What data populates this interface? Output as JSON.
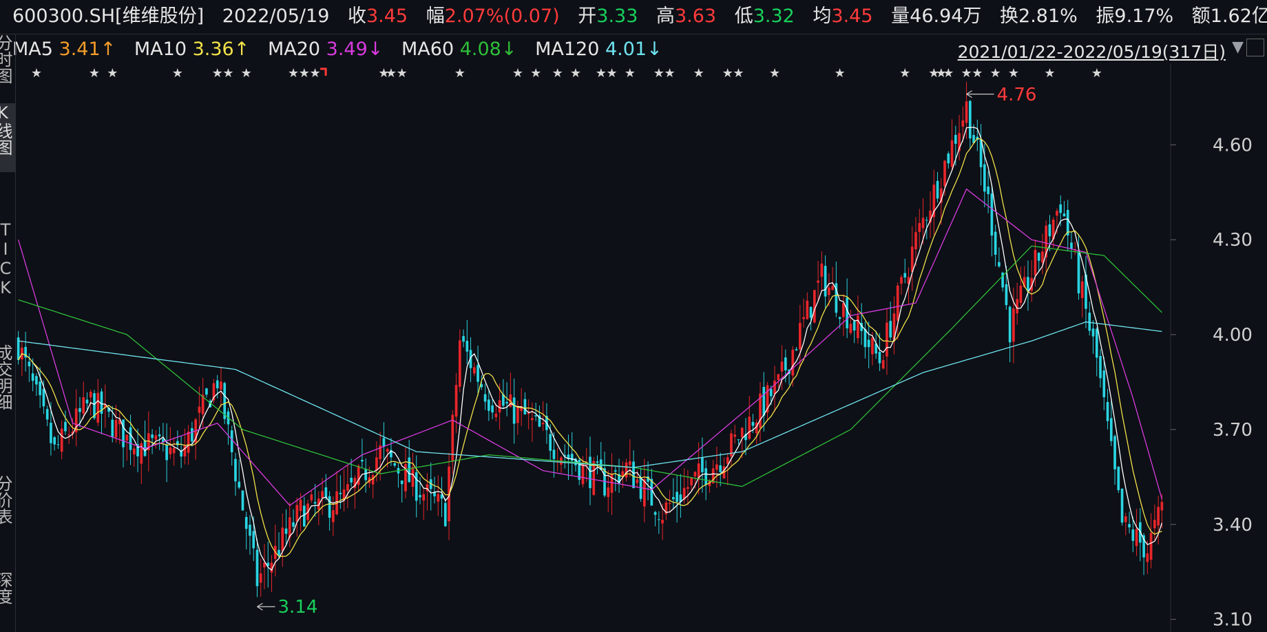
{
  "header": {
    "code": "600300.SH[维维股份]",
    "date": "2022/05/19",
    "close_label": "收",
    "close": "3.45",
    "change_label": "幅",
    "change": "2.07%(0.07)",
    "open_label": "开",
    "open": "3.33",
    "high_label": "高",
    "high": "3.63",
    "low_label": "低",
    "low": "3.32",
    "avg_label": "均",
    "avg": "3.45",
    "vol_label": "量",
    "vol": "46.94万",
    "turnover_label": "换",
    "turnover": "2.81%",
    "amp_label": "振",
    "amp": "9.17%",
    "amount_label": "额",
    "amount": "1.62亿"
  },
  "ma": {
    "ma5_label": "MA5",
    "ma5": "3.41↑",
    "ma10_label": "MA10",
    "ma10": "3.36↑",
    "ma20_label": "MA20",
    "ma20": "3.49↓",
    "ma60_label": "MA60",
    "ma60": "4.08↓",
    "ma120_label": "MA120",
    "ma120": "4.01↓"
  },
  "range": "2021/01/22-2022/05/19(317日)",
  "left_tabs": [
    "分时图",
    "K线图",
    "TICK",
    "成交明细",
    "分价表",
    "深度"
  ],
  "colors": {
    "up": "#e8262b",
    "down": "#2ad4e2",
    "ma5": "#ffffff",
    "ma10": "#f3e24a",
    "ma20": "#d93be0",
    "ma60": "#2fbf3a",
    "ma120": "#6fe4f0"
  },
  "chart_data": {
    "type": "candlestick",
    "y_ticks": [
      "4.60",
      "4.30",
      "4.00",
      "3.70",
      "3.40",
      "3.10"
    ],
    "ylim": [
      3.06,
      4.84
    ],
    "days": 317,
    "high_annotation": "4.76",
    "low_annotation": "3.14",
    "close_series": [
      [
        0,
        3.97
      ],
      [
        10,
        3.63
      ],
      [
        20,
        3.79
      ],
      [
        30,
        3.67
      ],
      [
        45,
        3.62
      ],
      [
        55,
        3.86
      ],
      [
        66,
        3.22
      ],
      [
        78,
        3.44
      ],
      [
        90,
        3.48
      ],
      [
        100,
        3.63
      ],
      [
        112,
        3.5
      ],
      [
        118,
        3.44
      ],
      [
        122,
        3.98
      ],
      [
        130,
        3.8
      ],
      [
        140,
        3.74
      ],
      [
        150,
        3.63
      ],
      [
        162,
        3.53
      ],
      [
        168,
        3.58
      ],
      [
        178,
        3.44
      ],
      [
        185,
        3.52
      ],
      [
        195,
        3.62
      ],
      [
        210,
        3.84
      ],
      [
        222,
        4.18
      ],
      [
        238,
        3.92
      ],
      [
        248,
        4.3
      ],
      [
        262,
        4.72
      ],
      [
        268,
        4.42
      ],
      [
        274,
        4.02
      ],
      [
        288,
        4.42
      ],
      [
        298,
        3.92
      ],
      [
        305,
        3.4
      ],
      [
        312,
        3.32
      ],
      [
        316,
        3.45
      ]
    ],
    "ma20_series": [
      [
        0,
        4.3
      ],
      [
        15,
        3.72
      ],
      [
        35,
        3.64
      ],
      [
        55,
        3.72
      ],
      [
        75,
        3.46
      ],
      [
        95,
        3.62
      ],
      [
        120,
        3.73
      ],
      [
        145,
        3.57
      ],
      [
        175,
        3.51
      ],
      [
        205,
        3.8
      ],
      [
        230,
        4.06
      ],
      [
        248,
        4.1
      ],
      [
        262,
        4.46
      ],
      [
        280,
        4.3
      ],
      [
        295,
        4.26
      ],
      [
        308,
        3.8
      ],
      [
        316,
        3.48
      ]
    ],
    "ma60_series": [
      [
        0,
        4.11
      ],
      [
        30,
        4.0
      ],
      [
        62,
        3.7
      ],
      [
        100,
        3.56
      ],
      [
        130,
        3.62
      ],
      [
        170,
        3.58
      ],
      [
        200,
        3.52
      ],
      [
        230,
        3.7
      ],
      [
        258,
        4.02
      ],
      [
        280,
        4.28
      ],
      [
        300,
        4.25
      ],
      [
        316,
        4.07
      ]
    ],
    "ma120_series": [
      [
        0,
        3.98
      ],
      [
        60,
        3.89
      ],
      [
        110,
        3.63
      ],
      [
        170,
        3.58
      ],
      [
        200,
        3.63
      ],
      [
        250,
        3.88
      ],
      [
        280,
        3.98
      ],
      [
        295,
        4.04
      ],
      [
        316,
        4.01
      ]
    ],
    "star_days": [
      5,
      21,
      26,
      44,
      55,
      58,
      63,
      76,
      79,
      82,
      101,
      103,
      106,
      122,
      138,
      143,
      149,
      154,
      161,
      164,
      169,
      177,
      180,
      188,
      196,
      199,
      209,
      227,
      245,
      253,
      255,
      257,
      262,
      265,
      270,
      275,
      285,
      298
    ],
    "flag_day": 84
  }
}
